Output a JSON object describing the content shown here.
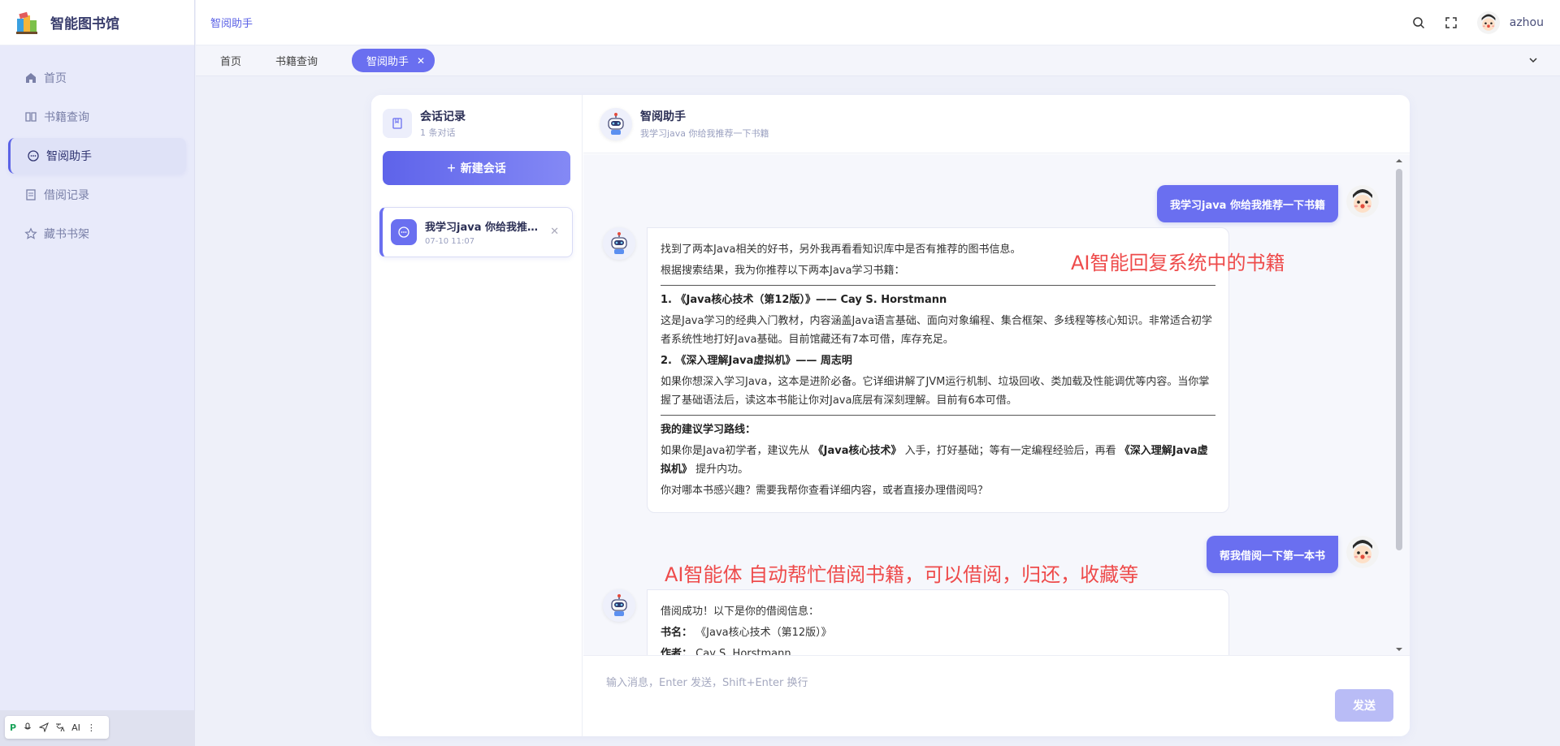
{
  "app": {
    "title": "智能图书馆"
  },
  "sidebar": {
    "items": [
      {
        "label": "首页",
        "icon": "home-icon",
        "active": false
      },
      {
        "label": "书籍查询",
        "icon": "book-open-icon",
        "active": false
      },
      {
        "label": "智阅助手",
        "icon": "chat-icon",
        "active": true
      },
      {
        "label": "借阅记录",
        "icon": "document-icon",
        "active": false
      },
      {
        "label": "藏书书架",
        "icon": "star-icon",
        "active": false
      }
    ]
  },
  "header": {
    "breadcrumb": "智阅助手",
    "username": "azhou"
  },
  "tabs": [
    {
      "label": "首页"
    },
    {
      "label": "书籍查询"
    },
    {
      "label": "智阅助手",
      "active": true
    }
  ],
  "sessions": {
    "title": "会话记录",
    "count_text": "1 条对话",
    "new_button": "新建会话",
    "items": [
      {
        "title": "我学习java 你给我推荐一下书籍",
        "time": "07-10 11:07"
      }
    ]
  },
  "chat": {
    "title": "智阅助手",
    "subtitle": "我学习java 你给我推荐一下书籍",
    "messages": {
      "user1": "我学习java  你给我推荐一下书籍",
      "bot1": {
        "intro": "找到了两本Java相关的好书，另外我再看看知识库中是否有推荐的图书信息。",
        "lead": "根据搜索结果，我为你推荐以下两本Java学习书籍：",
        "book1_title": "1. 《Java核心技术（第12版）》—— Cay S. Horstmann",
        "book1_desc": "这是Java学习的经典入门教材，内容涵盖Java语言基础、面向对象编程、集合框架、多线程等核心知识。非常适合初学者系统性地打好Java基础。目前馆藏还有7本可借，库存充足。",
        "book2_title": "2. 《深入理解Java虚拟机》—— 周志明",
        "book2_desc": "如果你想深入学习Java，这本是进阶必备。它详细讲解了JVM运行机制、垃圾回收、类加载及性能调优等内容。当你掌握了基础语法后，读这本书能让你对Java底层有深刻理解。目前有6本可借。",
        "route_title": "我的建议学习路线：",
        "route_pre": "如果你是Java初学者，建议先从",
        "route_b1": "《Java核心技术》",
        "route_mid": "入手，打好基础；等有一定编程经验后，再看",
        "route_b2": "《深入理解Java虚拟机》",
        "route_post": "提升内功。",
        "question": "你对哪本书感兴趣？需要我帮你查看详细内容，或者直接办理借阅吗？"
      },
      "user2": "帮我借阅一下第一本书",
      "bot2": {
        "intro": "借阅成功！以下是你的借阅信息：",
        "name_label": "书名：",
        "name_value": "《Java核心技术（第12版）》",
        "author_label": "作者：",
        "author_value": "Cay S. Horstmann"
      }
    },
    "input_placeholder": "输入消息，Enter 发送，Shift+Enter 换行",
    "send_label": "发送"
  },
  "annotations": {
    "a1": "AI智能回复系统中的书籍",
    "a2": "AI智能体 自动帮忙借阅书籍，可以借阅，归还，收藏等"
  },
  "ime": {
    "ai_label": "AI"
  },
  "colors": {
    "accent": "#6a6ff0",
    "annotation": "#ee4b4b"
  }
}
